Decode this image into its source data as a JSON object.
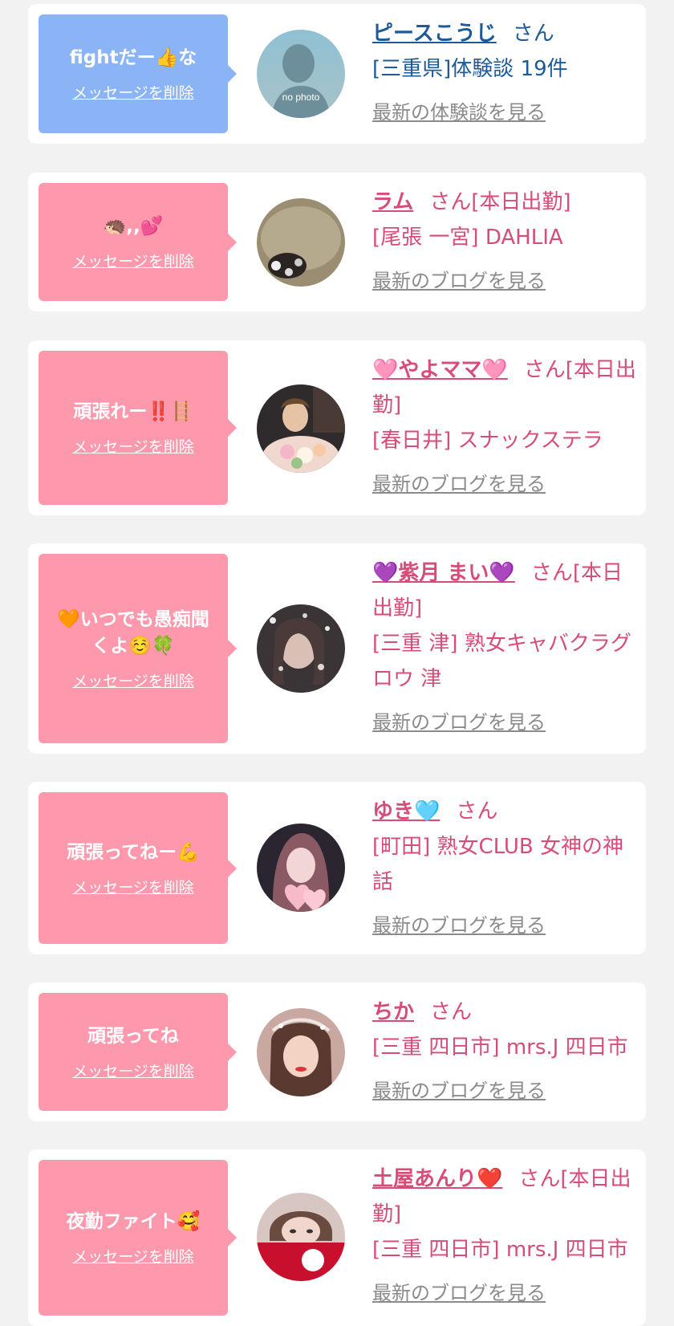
{
  "messages": [
    {
      "bubble": {
        "text": "fightだー👍な",
        "delete_label": "メッセージを削除"
      },
      "avatar": {
        "alt_text": "no photo"
      },
      "name": "ピースこうじ",
      "suffix": "さん",
      "detail": "[三重県]体験談 19件",
      "link": "最新の体験談を見る"
    },
    {
      "bubble": {
        "text": "🦔,,💕",
        "delete_label": "メッセージを削除"
      },
      "name": "ラム",
      "suffix": "さん[本日出勤]",
      "detail": "[尾張 一宮] DAHLIA",
      "link": "最新のブログを見る"
    },
    {
      "bubble": {
        "text": "頑張れー‼️🪜",
        "delete_label": "メッセージを削除"
      },
      "name": "🩷やよママ🩷",
      "suffix": "さん[本日出勤]",
      "detail": "[春日井] スナックステラ",
      "link": "最新のブログを見る"
    },
    {
      "bubble": {
        "text": "🧡いつでも愚痴聞くよ☺️🍀",
        "delete_label": "メッセージを削除"
      },
      "name": "💜紫月 まい💜",
      "suffix": "さん[本日出勤]",
      "detail": "[三重 津] 熟女キャバクラグロウ 津",
      "link": "最新のブログを見る"
    },
    {
      "bubble": {
        "text": "頑張ってねー💪",
        "delete_label": "メッセージを削除"
      },
      "name": "ゆき🩵",
      "suffix": "さん",
      "detail": "[町田] 熟女CLUB 女神の神話",
      "link": "最新のブログを見る"
    },
    {
      "bubble": {
        "text": "頑張ってね",
        "delete_label": "メッセージを削除"
      },
      "name": "ちか",
      "suffix": "さん",
      "detail": "[三重 四日市] mrs.J 四日市",
      "link": "最新のブログを見る"
    },
    {
      "bubble": {
        "text": "夜勤ファイト🥰",
        "delete_label": "メッセージを削除"
      },
      "name": "土屋あんり❤️",
      "suffix": "さん[本日出勤]",
      "detail": "[三重 四日市] mrs.J 四日市",
      "link": "最新のブログを見る"
    }
  ]
}
